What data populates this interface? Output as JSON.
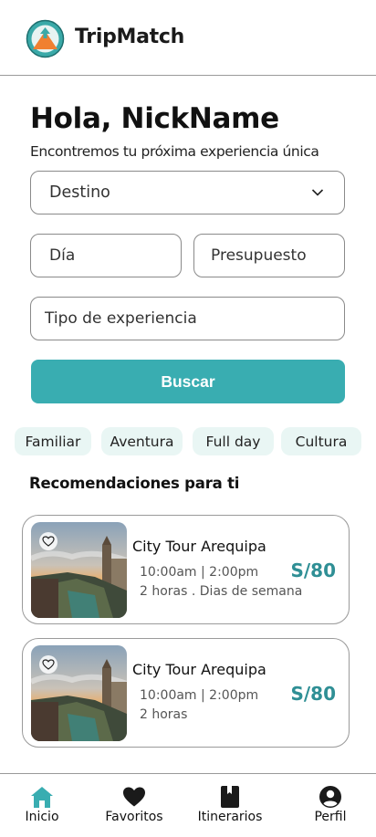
{
  "header": {
    "brand": "TripMatch",
    "logo_icon": "tripmatch-mountain-logo"
  },
  "greeting": {
    "title": "Hola, NickName",
    "subtitle": "Encontremos tu próxima experiencia única"
  },
  "search": {
    "destino": {
      "placeholder": "Destino",
      "icon": "chevron-down-icon"
    },
    "dia": {
      "placeholder": "Día"
    },
    "presupuesto": {
      "placeholder": "Presupuesto"
    },
    "tipo": {
      "placeholder": "Tipo de experiencia"
    },
    "button_label": "Buscar"
  },
  "chips": [
    "Familiar",
    "Aventura",
    "Full day",
    "Cultura"
  ],
  "recommendations": {
    "title": "Recomendaciones para ti",
    "items": [
      {
        "title": "City Tour Arequipa",
        "schedule": "10:00am | 2:00pm",
        "duration": "2 horas . Dias de semana",
        "price": "S/80"
      },
      {
        "title": "City Tour Arequipa",
        "schedule": "10:00am | 2:00pm",
        "duration": "2 horas",
        "price": "S/80"
      }
    ]
  },
  "nav": [
    {
      "label": "Inicio",
      "icon": "home-icon",
      "active": true
    },
    {
      "label": "Favoritos",
      "icon": "heart-icon"
    },
    {
      "label": "Itinerarios",
      "icon": "book-icon"
    },
    {
      "label": "Perfil",
      "icon": "user-icon"
    }
  ],
  "colors": {
    "accent": "#39adb1",
    "price": "#2f8f95",
    "chip_bg": "#e9f6f4",
    "logo_orange": "#f08030"
  }
}
